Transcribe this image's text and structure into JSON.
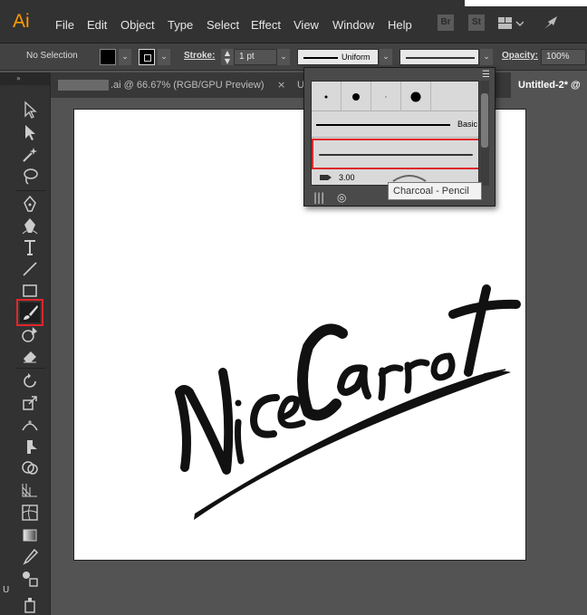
{
  "app": {
    "logo": "Ai"
  },
  "menu": [
    "File",
    "Edit",
    "Object",
    "Type",
    "Select",
    "Effect",
    "View",
    "Window",
    "Help"
  ],
  "app_badges": [
    "Br",
    "St"
  ],
  "control_bar": {
    "selection": "No Selection",
    "stroke_label": "Stroke:",
    "stroke_weight": "1 pt",
    "stroke_profile": "Uniform",
    "opacity_label": "Opacity:",
    "opacity_value": "100%"
  },
  "tabs": [
    {
      "label": ".ai @ 66.67% (RGB/GPU Preview)",
      "active": false,
      "close": "×"
    },
    {
      "label": "U",
      "active": false,
      "close": ""
    },
    {
      "label": "Untitled-2* @",
      "active": true,
      "close": ""
    }
  ],
  "brush_panel": {
    "basic_label": "Basic",
    "partial_value": "3.00",
    "tooltip": "Charcoal - Pencil",
    "dots": [
      3,
      8,
      2,
      11
    ]
  },
  "artwork": {
    "text": "NiceCarrot"
  },
  "ghost_text": "U",
  "colors": {
    "highlight": "#e0262b",
    "accent": "#ff9a00"
  }
}
